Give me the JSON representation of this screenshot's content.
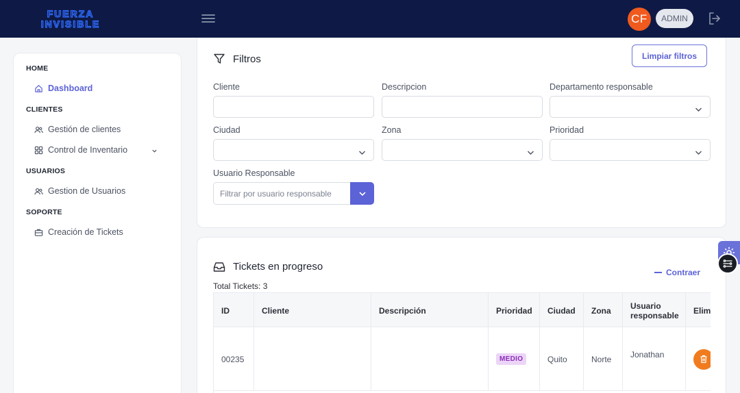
{
  "app": {
    "logo_line1": "FUERZA",
    "logo_line2": "INVISIBLE",
    "user_initials": "CF",
    "user_role": "ADMIN"
  },
  "colors": {
    "topbar": "#0e1a45",
    "accent": "#5c63d6",
    "avatar": "#f05a1e",
    "delete": "#f07c1f"
  },
  "sidebar": {
    "sections": [
      {
        "title": "HOME",
        "items": [
          {
            "label": "Dashboard",
            "icon": "home-icon",
            "active": true
          }
        ]
      },
      {
        "title": "CLIENTES",
        "items": [
          {
            "label": "Gestión de clientes",
            "icon": "users-icon"
          },
          {
            "label": "Control de Inventario",
            "icon": "grid-icon",
            "expandable": true
          }
        ]
      },
      {
        "title": "USUARIOS",
        "items": [
          {
            "label": "Gestion de Usuarios",
            "icon": "users-icon"
          }
        ]
      },
      {
        "title": "SOPORTE",
        "items": [
          {
            "label": "Creación de Tickets",
            "icon": "briefcase-icon"
          }
        ]
      }
    ]
  },
  "filters": {
    "title": "Filtros",
    "clear_label": "Limpiar filtros",
    "fields": {
      "cliente": {
        "label": "Cliente",
        "value": ""
      },
      "descripcion": {
        "label": "Descripcion",
        "value": ""
      },
      "departamento": {
        "label": "Departamento responsable",
        "value": ""
      },
      "ciudad": {
        "label": "Ciudad",
        "value": ""
      },
      "zona": {
        "label": "Zona",
        "value": ""
      },
      "prioridad": {
        "label": "Prioridad",
        "value": ""
      },
      "usuario": {
        "label": "Usuario Responsable",
        "placeholder": "Filtrar por usuario responsable"
      }
    }
  },
  "tickets": {
    "title": "Tickets en progreso",
    "collapse_label": "Contraer",
    "total_label": "Total Tickets: 3",
    "columns": [
      "ID",
      "Cliente",
      "Descripción",
      "Prioridad",
      "Ciudad",
      "Zona",
      "Usuario responsable",
      "Elim"
    ],
    "rows": [
      {
        "id": "00235",
        "cliente": "",
        "descripcion": "",
        "prioridad": "MEDIO",
        "ciudad": "Quito",
        "zona": "Norte",
        "usuario": "Jonathan"
      }
    ]
  }
}
